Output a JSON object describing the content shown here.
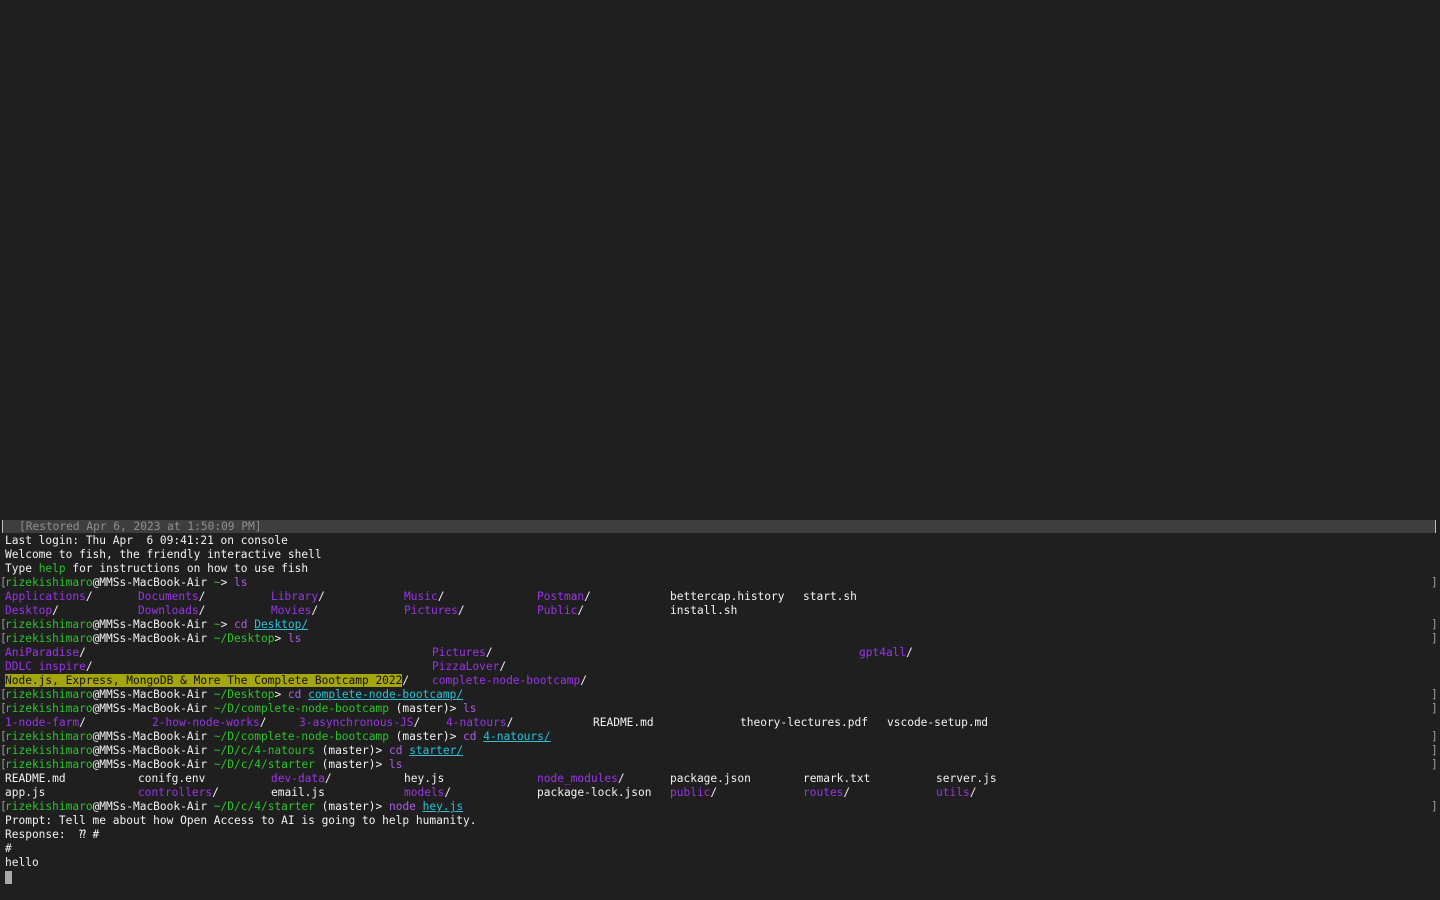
{
  "terminal": {
    "restored": "[Restored Apr 6, 2023 at 1:50:09 PM]",
    "last_login": "Last login: Thu Apr  6 09:41:21 on console",
    "welcome": "Welcome to fish, the friendly interactive shell",
    "type_help_pre": "Type ",
    "type_help_cmd": "help",
    "type_help_post": " for instructions on how to use fish",
    "user": "rizekishimaro",
    "host": "@MMSs-MacBook-Air",
    "prompt": {
      "p1": {
        "cwd": " ~",
        "sym": "> ",
        "cmd": "ls",
        "arg": ""
      },
      "p2": {
        "cwd": " ~",
        "sym": "> ",
        "cmd": "cd ",
        "arg": "Desktop/"
      },
      "p3": {
        "cwd": " ~/Desktop",
        "sym": "> ",
        "cmd": "ls",
        "arg": ""
      },
      "p4": {
        "cwd": " ~/Desktop",
        "sym": "> ",
        "cmd": "cd ",
        "arg": "complete-node-bootcamp/"
      },
      "p5": {
        "cwd": " ~/D/complete-node-bootcamp",
        "branch": " (master)",
        "sym": "> ",
        "cmd": "ls",
        "arg": ""
      },
      "p6": {
        "cwd": " ~/D/complete-node-bootcamp",
        "branch": " (master)",
        "sym": "> ",
        "cmd": "cd ",
        "arg": "4-natours/"
      },
      "p7": {
        "cwd": " ~/D/c/4-natours",
        "branch": " (master)",
        "sym": "> ",
        "cmd": "cd ",
        "arg": "starter/"
      },
      "p8": {
        "cwd": " ~/D/c/4/starter",
        "branch": " (master)",
        "sym": "> ",
        "cmd": "ls",
        "arg": ""
      },
      "p9": {
        "cwd": " ~/D/c/4/starter",
        "branch": " (master)",
        "sym": "> ",
        "cmd": "node ",
        "arg": "hey.js"
      }
    },
    "home_ls": {
      "r1": [
        "Applications",
        "Documents",
        "Library",
        "Music",
        "Postman",
        "bettercap.history",
        "start.sh"
      ],
      "r2": [
        "Desktop",
        "Downloads",
        "Movies",
        "Pictures",
        "Public",
        "install.sh"
      ]
    },
    "desktop_ls": {
      "r1": [
        "AniParadise",
        "Pictures",
        "gpt4all"
      ],
      "r2": [
        "DDLC inspire",
        "PizzaLover"
      ],
      "r3": [
        "Node.js, Express, MongoDB & More The Complete Bootcamp 2022",
        "complete-node-bootcamp"
      ]
    },
    "bootcamp_ls": [
      "1-node-farm",
      "2-how-node-works",
      "3-asynchronous-JS",
      "4-natours",
      "README.md",
      "theory-lectures.pdf",
      "vscode-setup.md"
    ],
    "starter_ls": {
      "r1": [
        "README.md",
        "conifg.env",
        "dev-data",
        "hey.js",
        "node_modules",
        "package.json",
        "remark.txt",
        "server.js"
      ],
      "r2": [
        "app.js",
        "controllers",
        "email.js",
        "models",
        "package-lock.json",
        "public",
        "routes",
        "utils"
      ]
    },
    "output": {
      "prompt_line": "Prompt: Tell me about how Open Access to AI is going to help humanity.",
      "response_line": "Response:  ⁇ #",
      "hash_line": "#",
      "hello_line": "hello"
    },
    "slash": "/",
    "bracket_left": "[",
    "bracket_right": "]"
  }
}
